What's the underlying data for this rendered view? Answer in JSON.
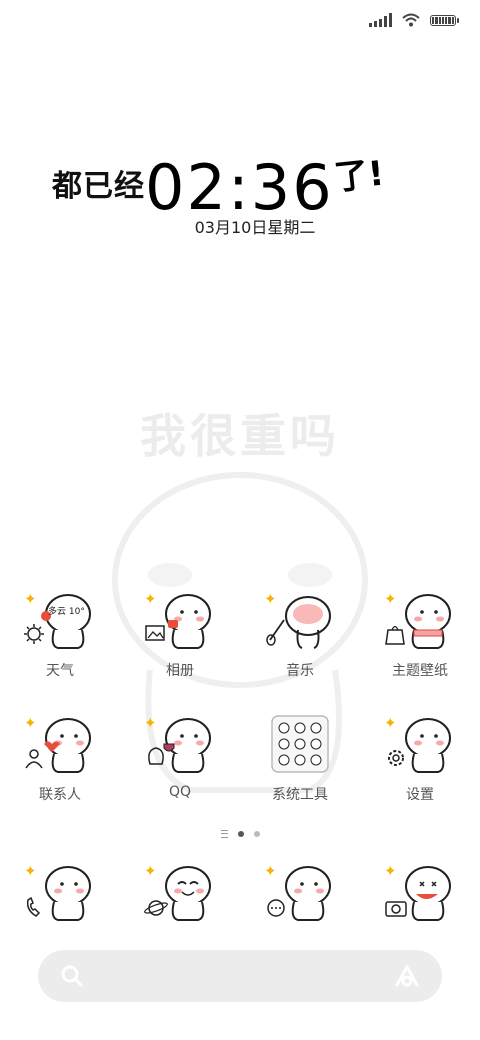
{
  "status_bar": {
    "signal_icon": "signal-icon",
    "wifi_icon": "wifi-icon",
    "battery_icon": "battery-icon"
  },
  "clock_widget": {
    "prefix": "都已经",
    "time": "02:36",
    "suffix": "了!",
    "date": "03月10日星期二"
  },
  "wallpaper": {
    "watermark_text": "我很重吗"
  },
  "apps_row1": [
    {
      "label": "天气",
      "icon": "weather-icon",
      "weather_text": "多云 10°"
    },
    {
      "label": "相册",
      "icon": "gallery-icon"
    },
    {
      "label": "音乐",
      "icon": "music-icon"
    },
    {
      "label": "主题壁纸",
      "icon": "themes-icon"
    }
  ],
  "apps_row2": [
    {
      "label": "联系人",
      "icon": "contacts-icon"
    },
    {
      "label": "QQ",
      "icon": "qq-icon"
    },
    {
      "label": "系统工具",
      "icon": "system-tools-folder-icon"
    },
    {
      "label": "设置",
      "icon": "settings-icon"
    }
  ],
  "pager": {
    "pages": 3,
    "active_index": 1
  },
  "dock": [
    {
      "icon": "phone-icon"
    },
    {
      "icon": "browser-icon"
    },
    {
      "icon": "messages-icon"
    },
    {
      "icon": "camera-icon"
    }
  ],
  "search_bar": {
    "search_icon": "search-icon",
    "assistant_icon": "assistant-icon"
  },
  "colors": {
    "sparkle": "#f5b400",
    "search_bg": "#ececec",
    "blush": "#f7a8a8"
  }
}
